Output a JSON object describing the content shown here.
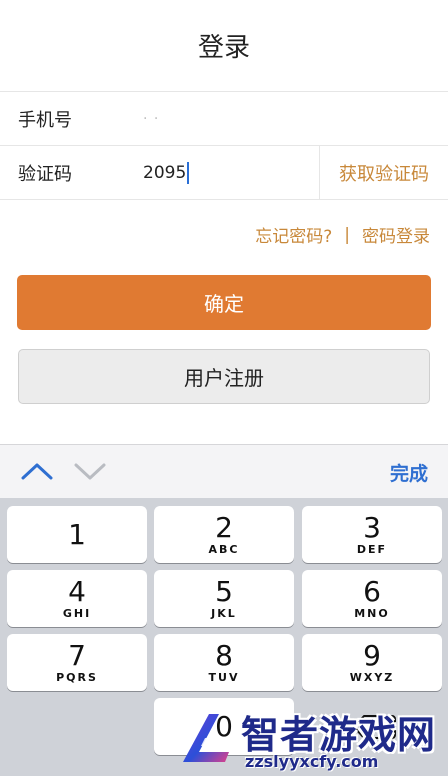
{
  "header": {
    "title": "登录"
  },
  "form": {
    "phone_label": "手机号",
    "phone_value": "· ·",
    "code_label": "验证码",
    "code_value": "2095",
    "get_code_button": "获取验证码"
  },
  "links": {
    "forgot": "忘记密码?",
    "separator": "|",
    "password_login": "密码登录"
  },
  "buttons": {
    "confirm": "确定",
    "register": "用户注册"
  },
  "keyboard": {
    "done": "完成",
    "keys": [
      {
        "digit": "1",
        "letters": ""
      },
      {
        "digit": "2",
        "letters": "ABC"
      },
      {
        "digit": "3",
        "letters": "DEF"
      },
      {
        "digit": "4",
        "letters": "GHI"
      },
      {
        "digit": "5",
        "letters": "JKL"
      },
      {
        "digit": "6",
        "letters": "MNO"
      },
      {
        "digit": "7",
        "letters": "PQRS"
      },
      {
        "digit": "8",
        "letters": "TUV"
      },
      {
        "digit": "9",
        "letters": "WXYZ"
      },
      {
        "digit": "0",
        "letters": ""
      }
    ]
  },
  "watermark": {
    "name": "智者游戏网",
    "url": "zzslyyxcfy.com"
  },
  "colors": {
    "accent": "#e07a32",
    "link": "#c8883a",
    "done": "#2f6fd1",
    "keyboard_bg": "#cfd2d8"
  }
}
